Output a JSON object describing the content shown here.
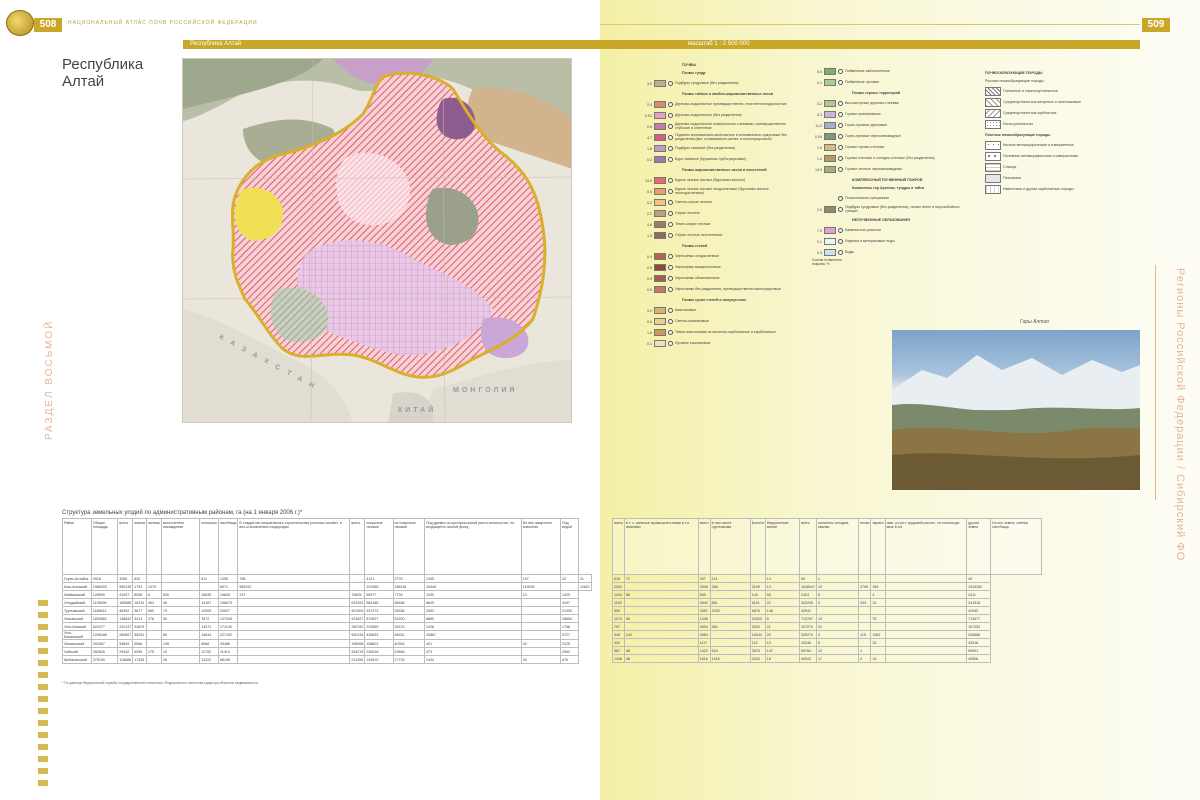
{
  "header": {
    "page_left": "508",
    "page_right": "509",
    "atlas_title": "НАЦИОНАЛЬНЫЙ АТЛАС ПОЧВ РОССИЙСКОЙ ФЕДЕРАЦИИ",
    "band_title": "Республика Алтай",
    "band_scale": "масштаб 1 : 2 500 000"
  },
  "region": {
    "title_line1": "Республика",
    "title_line2": "Алтай"
  },
  "map": {
    "labels": {
      "kazakhstan": "К А З А Х С Т А Н",
      "mongolia": "МОНГОЛИЯ",
      "china": "КИТАЙ"
    },
    "colors": {
      "border": "#d9b02a",
      "hatch_red": "#e05a6a",
      "hatch_pink": "#f2a7b4",
      "grey_green": "#9aa08a",
      "lilac": "#c9a7d6",
      "yellow": "#f1df55"
    }
  },
  "legend": {
    "col1_head": "ПОЧВЫ",
    "col1": [
      {
        "section": "Почвы тундр"
      },
      {
        "v": "3.0",
        "c": "#bfae8a",
        "t": "Подбуры тундровые (без разделения)"
      },
      {
        "section": "Почвы таёжно и хвойно-широколиственных лесов"
      },
      {
        "v": "2.4",
        "c": "#d98a6a",
        "t": "Дерново-подзолистые преимущественно, неоглеенноподзолистые"
      },
      {
        "v": "0.01",
        "c": "#e8a3b8",
        "t": "Дерново-подзолистые (без разделения)"
      },
      {
        "v": "2.6",
        "c": "#c77ba8",
        "t": "Дерново-подзолистые поверхностно-глеевыми, преимущественно глубокие и оглеенные"
      },
      {
        "v": "4.7",
        "c": "#d55c8a",
        "t": "Подзолы иллювиально-железистые и иллювиально-гумусовые без разделения (вкл. иллювиально-желез. и многогумусовые)"
      },
      {
        "v": "1.6",
        "c": "#b9a1c6",
        "t": "Подбуры таежные (без разделения)"
      },
      {
        "v": "0.2",
        "c": "#9c7ab0",
        "t": "Буро-таежные (буроземы грубогумусовые)"
      },
      {
        "section": "Почвы широколиственных лесов и лесостепей"
      },
      {
        "v": "13.0",
        "c": "#e26c6c",
        "t": "Бурые лесные кислые (буроземы кислые)"
      },
      {
        "v": "0.6",
        "c": "#f09a70",
        "t": "Бурые лесные кислые оподзоленные (буроземы кислые неоподзоленные)"
      },
      {
        "v": "0.2",
        "c": "#f3c27c",
        "t": "Светло-серые лесные"
      },
      {
        "v": "2.2",
        "c": "#bf9d84",
        "t": "Серые лесные"
      },
      {
        "v": "4.6",
        "c": "#a07a60",
        "t": "Темно-серые лесные"
      },
      {
        "v": "1.3",
        "c": "#8b6f5a",
        "t": "Серые лесные неоглеенные"
      },
      {
        "section": "Почвы степей"
      },
      {
        "v": "0.4",
        "c": "#b06a4a",
        "t": "Черноземы оподзоленные"
      },
      {
        "v": "0.5",
        "c": "#8f4a3a",
        "t": "Черноземы выщелоченные"
      },
      {
        "v": "0.9",
        "c": "#a85c4c",
        "t": "Черноземы обыкновенные"
      },
      {
        "v": "0.5",
        "c": "#c27a66",
        "t": "Черноземы без разделения, преимущественно малогумусовые"
      },
      {
        "section": "Почвы сухих степей и полупустынь"
      },
      {
        "v": "3.2",
        "c": "#d9b46a",
        "t": "Каштановые"
      },
      {
        "v": "0.6",
        "c": "#e8cf98",
        "t": "Светло-каштановые"
      },
      {
        "v": "1.6",
        "c": "#c99a5a",
        "t": "Темно-каштановые иглистично-карбонатные и карбонатные"
      },
      {
        "v": "0.1",
        "c": "#f0e0b8",
        "t": "Луговые каштановые"
      }
    ],
    "col2_head": "Пойменные и маршевые почвы",
    "col2": [
      {
        "v": "0.5",
        "c": "#7fb06a",
        "t": "Пойменные заболоченные"
      },
      {
        "v": "0.1",
        "c": "#a6cf8a",
        "t": "Пойменные луговые"
      },
      {
        "section": "Почвы горных территорий"
      },
      {
        "v": "4.2",
        "c": "#b4c48a",
        "t": "Высокогорные дерново-глеевые"
      },
      {
        "v": "3.3",
        "c": "#c8b8da",
        "t": "Горные примитивные"
      },
      {
        "v": "11.0",
        "c": "#9fb0d0",
        "t": "Горно-луговые дерновые"
      },
      {
        "v": "0.04",
        "c": "#7a9a7a",
        "t": "Горно-луговые черноземовидные"
      },
      {
        "v": "1.9",
        "c": "#d2c07a",
        "t": "Горные лугово-степные"
      },
      {
        "v": "1.4",
        "c": "#b89a6a",
        "t": "Горные степные и холодно-степные (без разделения)"
      },
      {
        "v": "14.0",
        "c": "#a3b07f",
        "t": "Горные лесные черноземовидные"
      },
      {
        "section": "КОМПЛЕКСНЫЙ ПОЧВЕННЫЙ ПОКРОВ"
      },
      {
        "section": "Комплексы гор Арктики, тундры и тайги"
      },
      {
        "v": "",
        "c": "",
        "t": "Полигонально-трещинные"
      },
      {
        "v": "2.0",
        "c": "#8c8c70",
        "t": "Подбуры тундровые (без разделения), почвы пятен и морозобойных трещин"
      },
      {
        "section": "НЕПОЧВЕННЫЕ ОБРАЗОВАНИЯ"
      },
      {
        "v": "7.9",
        "c": "#e6a0d0",
        "t": "Каменистые россыпи"
      },
      {
        "v": "0.1",
        "c": "#e8f4fa",
        "t": "Ледники и материковые льды"
      },
      {
        "v": "0.3",
        "c": "#c9e3f2",
        "t": "Воды"
      }
    ],
    "col2_note": "Состав почвенного покрова, %",
    "col3_head": "ПОЧВООБРАЗУЮЩИЕ ПОРОДЫ",
    "col3_sub": "Рыхлые почвообразующие породы",
    "col3": [
      "Глинистые и тяжелосуглинистые",
      "Среднесуглинистые валунные и галечниковые",
      "Среднесуглинистые щебнистые",
      "Легкосуглинистые",
      "Плотные почвообразующие породы",
      "Кислые метаморфические и изверженные",
      "Основные метаморфические и изверженные",
      "Сланцы",
      "Песчаники",
      "Известняки и другие карбонатные породы"
    ]
  },
  "photo_caption": "Горы Алтая",
  "side": {
    "left": "РАЗДЕЛ ВОСЬМОЙ",
    "right": "Регионы Российской Федерации / Сибирский ФО"
  },
  "table": {
    "title": "Структура земельных угодий по административным районам, га (на 1 января 2006 г.)*",
    "left_headers": [
      "Район",
      "Общая площадь",
      "всего",
      "пашня",
      "залежь",
      "многолетние насаждения",
      "сенокосы",
      "пастбища",
      "В стадии ме-лиоративного строительства (сельско-хозяйст. и вос-становления плодородия",
      "всего",
      "покрытые лесами",
      "не покрытые лесами",
      "Под древес-но-кустарни-ковой расти-тельностью, не входящей в лесной фонд",
      "Из них защитного значения",
      "Под водой"
    ],
    "right_headers": [
      "всего",
      "в т. ч. занятые промышлен-ными и т.п. землями",
      "всего",
      "в том числе грунтовыми",
      "Болота",
      "Нарушенные земли",
      "всего",
      "полигоны отходов, свалки",
      "пески",
      "овраги",
      "ими. уч-ки с трудовой растит., не используе-мые в с/х",
      "другие земли",
      "Из них земли, оленьи пастбища"
    ],
    "rows": [
      {
        "l": [
          "Горно-Алтайск",
          "9018",
          "3066",
          "832",
          "",
          "",
          "811",
          "1255",
          "768",
          "",
          "4121",
          "2776",
          "1345",
          "197",
          "43",
          "21"
        ],
        "r": [
          "616",
          "72",
          "307",
          "114",
          "",
          "14",
          "59",
          "1",
          "",
          "",
          "",
          "49"
        ]
      },
      {
        "l": [
          "Кош-Агачский",
          "1986000",
          "596135",
          "1793",
          "1079",
          "",
          "",
          "8071",
          "585192",
          "",
          "201565",
          "186116",
          "15449",
          "119635",
          "",
          "12821"
        ],
        "r": [
          "2052",
          "",
          "2508",
          "266",
          "3199",
          "13",
          "1048047",
          "12",
          "3769",
          "394",
          "",
          "1043282"
        ]
      },
      {
        "l": [
          "Майминский",
          "128599",
          "41097",
          "8055",
          "6",
          "526",
          "16635",
          "16845",
          "237",
          "70805",
          "55977",
          "7726",
          "1030",
          "10",
          "1429"
        ],
        "r": [
          "1204",
          "58",
          "840",
          "",
          "140",
          "55",
          "2424",
          "8",
          "",
          "4",
          "",
          "2411"
        ]
      },
      {
        "l": [
          "Онгудайский",
          "1195596",
          "185586",
          "18234",
          "464",
          "46",
          "14167",
          "156673",
          "",
          "632351",
          "564185",
          "68166",
          "8849",
          "",
          "4197"
        ],
        "r": [
          "1153",
          "",
          "2842",
          "851",
          "8101",
          "22",
          "342235",
          "3",
          "343",
          "31",
          "",
          "341918"
        ]
      },
      {
        "l": [
          "Турочакский",
          "1186814",
          "46352",
          "5877",
          "560",
          "79",
          "12909",
          "20927",
          "",
          "907809",
          "937273",
          "92536",
          "2593",
          "",
          "21353"
        ],
        "r": [
          "590",
          "",
          "3357",
          "2239",
          "6878",
          "148",
          "42941",
          "",
          "",
          "",
          "",
          "42940"
        ]
      },
      {
        "l": [
          "Улаганский",
          "1830562",
          "138842",
          "3413",
          "376",
          "36",
          "7872",
          "127045",
          "",
          "921827",
          "870827",
          "51200",
          "8680",
          "",
          "28654"
        ],
        "r": [
          "1074",
          "36",
          "1248",
          "",
          "24303",
          "6",
          "713787",
          "15",
          "",
          "75",
          "",
          "713677"
        ]
      },
      {
        "l": [
          "Усть-Канский",
          "624377",
          "220137",
          "34629",
          "",
          "",
          "14371",
          "171140",
          "",
          "260782",
          "223659",
          "39123",
          "2426",
          "",
          "1796"
        ],
        "r": [
          "797",
          "",
          "3634",
          "454",
          "3304",
          "21",
          "107274",
          "21",
          "",
          "",
          "",
          "107253"
        ]
      },
      {
        "l": [
          "Усть-Коксинский",
          "1295186",
          "280807",
          "36251",
          "",
          "80",
          "14644",
          "227152",
          "",
          "500134",
          "435633",
          "64531",
          "42867",
          "",
          "9727"
        ],
        "r": [
          "949",
          "142",
          "2664",
          "",
          "18344",
          "20",
          "339274",
          "4",
          "115",
          "1262",
          "",
          "336888"
        ]
      },
      {
        "l": [
          "Чемальский",
          "301867",
          "54849",
          "6566",
          "",
          "149",
          "8668",
          "39466",
          "",
          "198955",
          "158601",
          "40354",
          "421",
          "42",
          "2125"
        ],
        "r": [
          "432",
          "",
          "1117",
          "",
          "112",
          "10",
          "43246",
          "8",
          "",
          "20",
          "",
          "43218"
        ]
      },
      {
        "l": [
          "Чойский",
          "352626",
          "29442",
          "6095",
          "175",
          "10",
          "11752",
          "11410",
          "",
          "254276",
          "230028",
          "23848",
          "973",
          "",
          "2560"
        ],
        "r": [
          "587",
          "48",
          "1422",
          "618",
          "3575",
          "147",
          "59784",
          "12",
          "1",
          "",
          "",
          "59691"
        ]
      },
      {
        "l": [
          "Шебалинский",
          "379150",
          "118688",
          "17328",
          "",
          "26",
          "13222",
          "88108",
          "",
          "211395",
          "193670",
          "17725",
          "2434",
          "35",
          "676"
        ],
        "r": [
          "1448",
          "48",
          "1616",
          "1415",
          "2343",
          "18",
          "40543",
          "17",
          "4",
          "16",
          "",
          "40506"
        ]
      }
    ],
    "footnote": "* По данным Федеральной службы государственной статистики, Федерального агентства кадастра объектов недвижимости."
  }
}
